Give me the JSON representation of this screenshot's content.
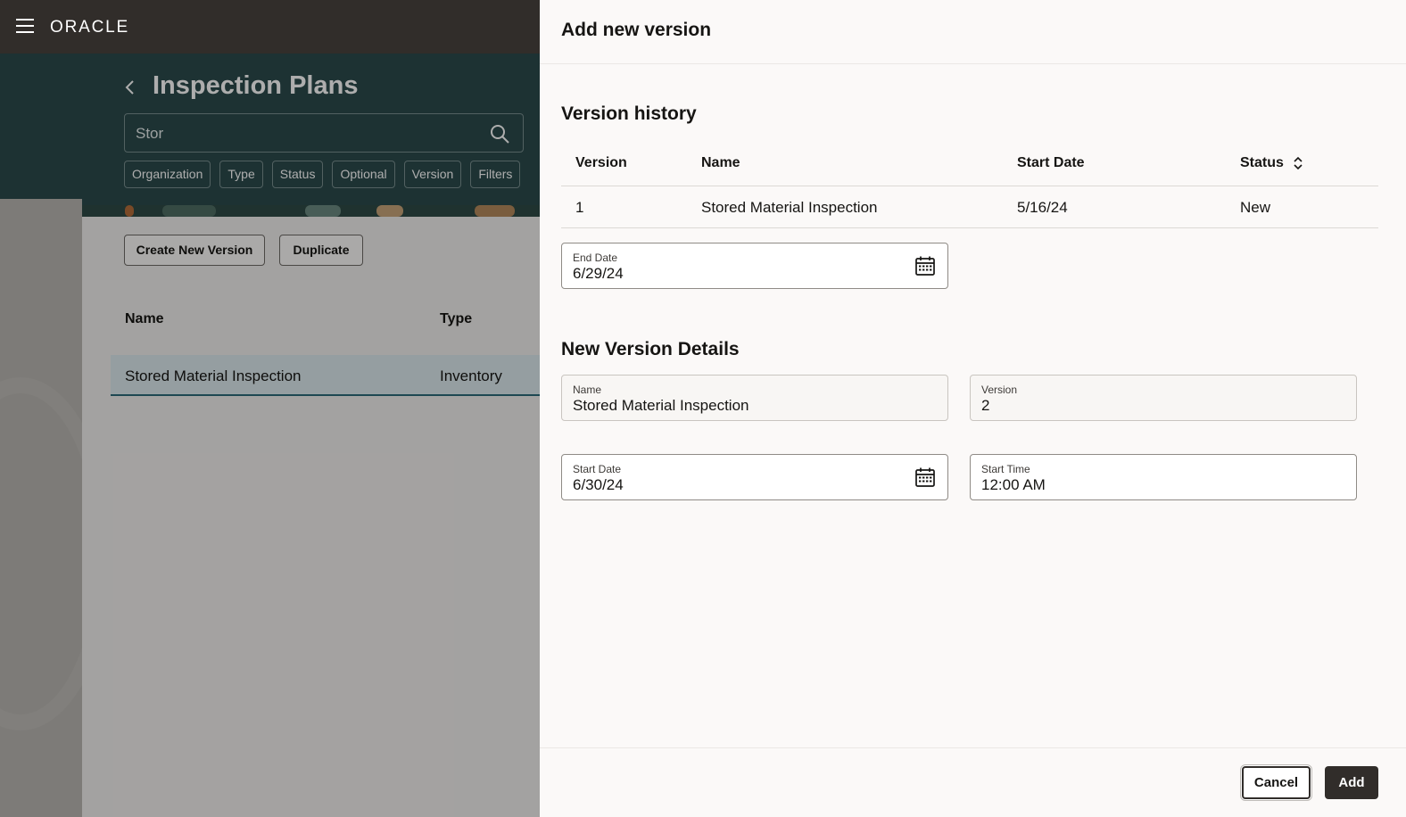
{
  "app": {
    "brand": "ORACLE"
  },
  "background": {
    "page_title": "Inspection Plans",
    "search": {
      "value": "Stor"
    },
    "filter_chips": [
      "Organization",
      "Type",
      "Status",
      "Optional",
      "Version",
      "Filters"
    ],
    "toolbar": {
      "create_new_version_label": "Create New Version",
      "duplicate_label": "Duplicate"
    },
    "table": {
      "columns": [
        "Name",
        "Type"
      ],
      "rows": [
        {
          "name": "Stored Material Inspection",
          "type": "Inventory"
        }
      ]
    }
  },
  "drawer": {
    "title": "Add new version",
    "version_history": {
      "title": "Version history",
      "columns": [
        "Version",
        "Name",
        "Start Date",
        "Status"
      ],
      "rows": [
        {
          "version": "1",
          "name": "Stored Material Inspection",
          "start_date": "5/16/24",
          "status": "New"
        }
      ],
      "end_date": {
        "label": "End Date",
        "value": "6/29/24"
      }
    },
    "new_version": {
      "title": "New Version Details",
      "name": {
        "label": "Name",
        "value": "Stored Material Inspection"
      },
      "version": {
        "label": "Version",
        "value": "2"
      },
      "start_date": {
        "label": "Start Date",
        "value": "6/30/24"
      },
      "start_time": {
        "label": "Start Time",
        "value": "12:00 AM"
      }
    },
    "footer": {
      "cancel_label": "Cancel",
      "add_label": "Add"
    }
  },
  "colors": {
    "header": "#312d2a",
    "teal_banner": "#2b4b4c",
    "primary_button": "#312d2a",
    "selected_row": "#dce9ee"
  }
}
